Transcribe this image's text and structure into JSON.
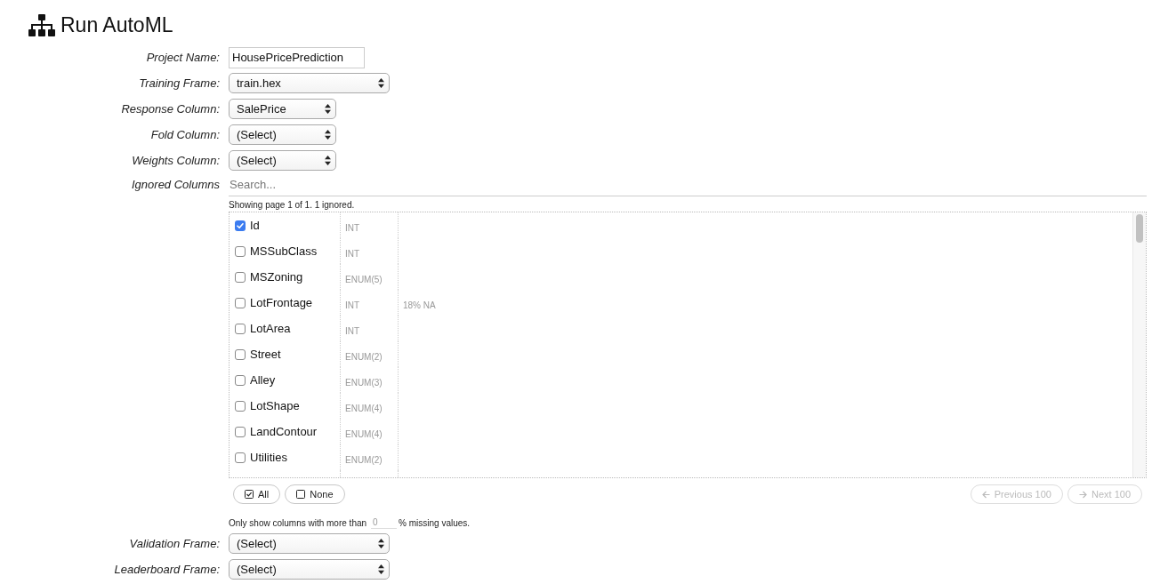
{
  "page": {
    "title": "Run AutoML"
  },
  "fields": [
    {
      "label": "Project Name:",
      "kind": "text",
      "value": "HousePricePrediction"
    },
    {
      "label": "Training Frame:",
      "kind": "frame",
      "value": "train.hex"
    },
    {
      "label": "Response Column:",
      "kind": "column",
      "value": "SalePrice"
    },
    {
      "label": "Fold Column:",
      "kind": "column",
      "value": "(Select)"
    },
    {
      "label": "Weights Column:",
      "kind": "column",
      "value": "(Select)"
    }
  ],
  "ignored_columns": {
    "label": "Ignored Columns",
    "search": {
      "placeholder": "Search..."
    },
    "status": "Showing page 1 of 1. 1 ignored.",
    "columns": [
      {
        "name": "Id",
        "type": "INT",
        "checked": true
      },
      {
        "name": "MSSubClass",
        "type": "INT",
        "checked": false
      },
      {
        "name": "MSZoning",
        "type": "ENUM(5)",
        "checked": false
      },
      {
        "name": "LotFrontage",
        "type": "INT",
        "missing": "18% NA",
        "checked": false
      },
      {
        "name": "LotArea",
        "type": "INT",
        "checked": false
      },
      {
        "name": "Street",
        "type": "ENUM(2)",
        "checked": false
      },
      {
        "name": "Alley",
        "type": "ENUM(3)",
        "checked": false
      },
      {
        "name": "LotShape",
        "type": "ENUM(4)",
        "checked": false
      },
      {
        "name": "LandContour",
        "type": "ENUM(4)",
        "checked": false
      },
      {
        "name": "Utilities",
        "type": "ENUM(2)",
        "checked": false
      }
    ],
    "select_buttons": [
      {
        "kind": "all",
        "label": "All"
      },
      {
        "kind": "none",
        "label": "None"
      }
    ],
    "pagination": [
      {
        "kind": "previous",
        "label": "Previous 100",
        "disabled": true
      },
      {
        "kind": "next",
        "label": "Next 100",
        "disabled": true
      }
    ],
    "missing_filter": {
      "prefix": "Only show columns with more than",
      "value": "0",
      "suffix": "% missing values."
    }
  },
  "frames": [
    {
      "label": "Validation Frame:",
      "kind": "frame",
      "value": "(Select)"
    },
    {
      "label": "Leaderboard Frame:",
      "kind": "frame",
      "value": "(Select)"
    }
  ]
}
